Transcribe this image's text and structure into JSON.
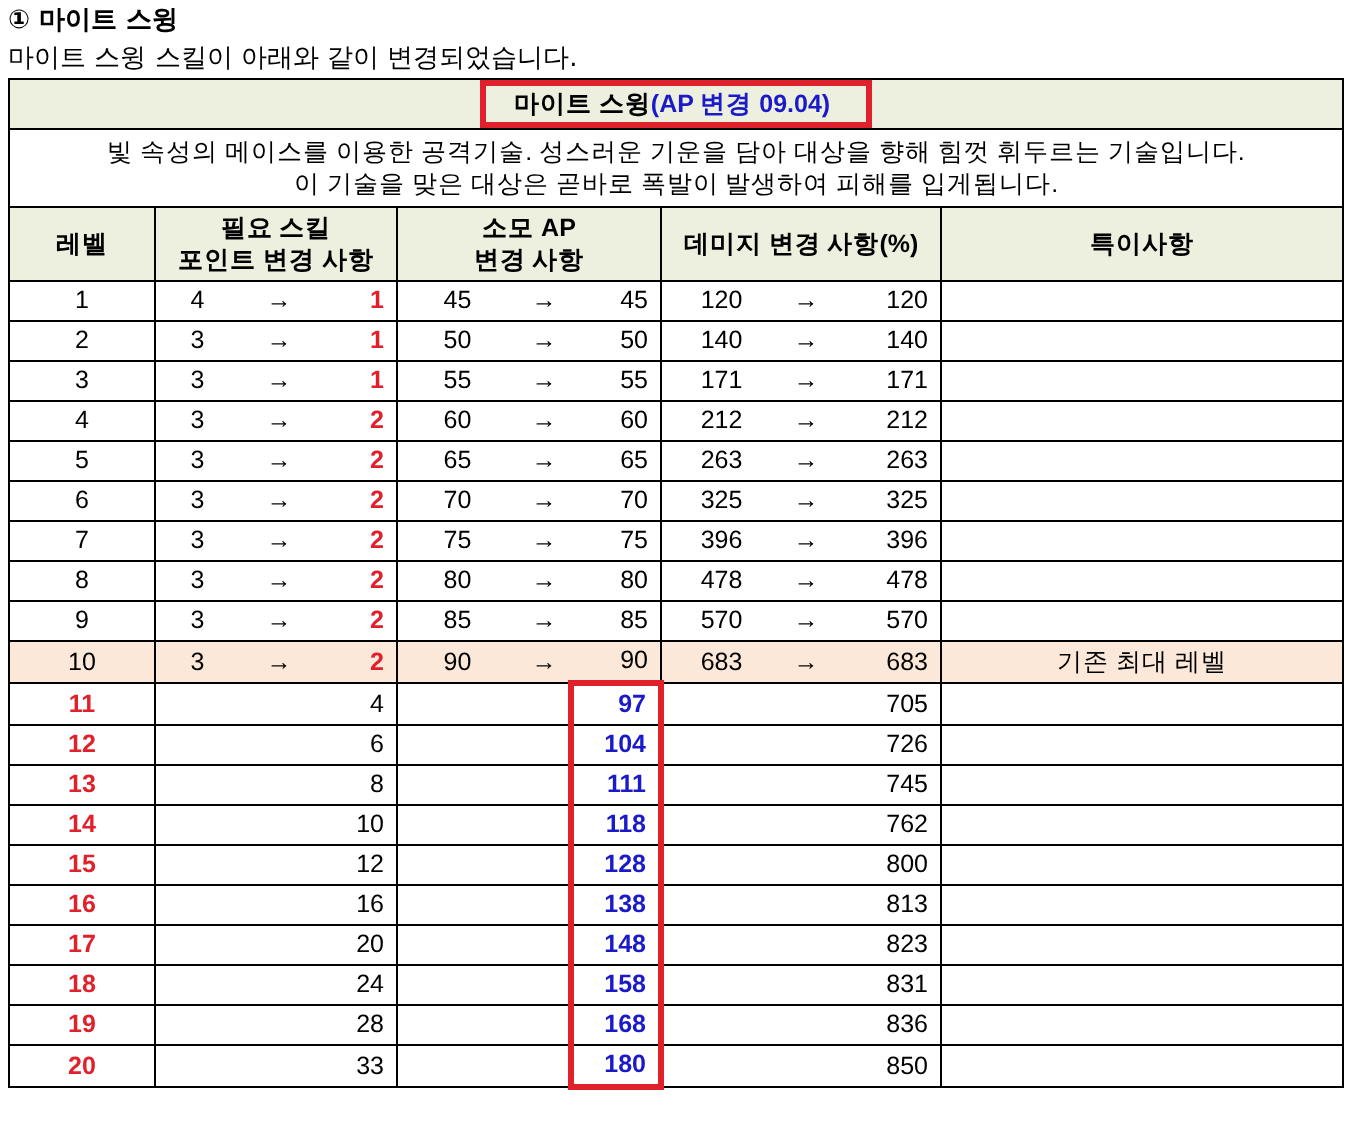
{
  "heading": "① 마이트 스윙",
  "intro": "마이트 스윙 스킬이 아래와 같이 변경되었습니다.",
  "table": {
    "title": {
      "name": "마이트 스윙",
      "note": "(AP 변경 09.04)"
    },
    "description": [
      "빛 속성의 메이스를 이용한 공격기술. 성스러운 기운을 담아 대상을 향해 힘껏 휘두르는 기술입니다.",
      "이 기술을 맞은 대상은 곧바로 폭발이 발생하여 피해를 입게됩니다."
    ],
    "columns": [
      [
        "레벨"
      ],
      [
        "필요 스킬",
        "포인트 변경 사항"
      ],
      [
        "소모 AP",
        "변경 사항"
      ],
      [
        "데미지 변경 사항(%)"
      ],
      [
        "특이사항"
      ]
    ],
    "rows": [
      {
        "kind": "existing",
        "highlighted": false,
        "level": "1",
        "skill": [
          "4",
          "→",
          "1"
        ],
        "ap": [
          "45",
          "→",
          "45"
        ],
        "damage": [
          "120",
          "→",
          "120"
        ]
      },
      {
        "kind": "existing",
        "highlighted": false,
        "level": "2",
        "skill": [
          "3",
          "→",
          "1"
        ],
        "ap": [
          "50",
          "→",
          "50"
        ],
        "damage": [
          "140",
          "→",
          "140"
        ]
      },
      {
        "kind": "existing",
        "highlighted": false,
        "level": "3",
        "skill": [
          "3",
          "→",
          "1"
        ],
        "ap": [
          "55",
          "→",
          "55"
        ],
        "damage": [
          "171",
          "→",
          "171"
        ]
      },
      {
        "kind": "existing",
        "highlighted": false,
        "level": "4",
        "skill": [
          "3",
          "→",
          "2"
        ],
        "ap": [
          "60",
          "→",
          "60"
        ],
        "damage": [
          "212",
          "→",
          "212"
        ]
      },
      {
        "kind": "existing",
        "highlighted": false,
        "level": "5",
        "skill": [
          "3",
          "→",
          "2"
        ],
        "ap": [
          "65",
          "→",
          "65"
        ],
        "damage": [
          "263",
          "→",
          "263"
        ]
      },
      {
        "kind": "existing",
        "highlighted": false,
        "level": "6",
        "skill": [
          "3",
          "→",
          "2"
        ],
        "ap": [
          "70",
          "→",
          "70"
        ],
        "damage": [
          "325",
          "→",
          "325"
        ]
      },
      {
        "kind": "existing",
        "highlighted": false,
        "level": "7",
        "skill": [
          "3",
          "→",
          "2"
        ],
        "ap": [
          "75",
          "→",
          "75"
        ],
        "damage": [
          "396",
          "→",
          "396"
        ]
      },
      {
        "kind": "existing",
        "highlighted": false,
        "level": "8",
        "skill": [
          "3",
          "→",
          "2"
        ],
        "ap": [
          "80",
          "→",
          "80"
        ],
        "damage": [
          "478",
          "→",
          "478"
        ]
      },
      {
        "kind": "existing",
        "highlighted": false,
        "level": "9",
        "skill": [
          "3",
          "→",
          "2"
        ],
        "ap": [
          "85",
          "→",
          "85"
        ],
        "damage": [
          "570",
          "→",
          "570"
        ]
      },
      {
        "kind": "existing",
        "highlighted": true,
        "level": "10",
        "skill": [
          "3",
          "→",
          "2"
        ],
        "ap": [
          "90",
          "→",
          "90"
        ],
        "damage": [
          "683",
          "→",
          "683"
        ],
        "note": "기존 최대 레벨"
      },
      {
        "kind": "added",
        "highlighted": false,
        "level": "11",
        "skill": [
          "4"
        ],
        "ap": [
          "97"
        ],
        "damage": [
          "705"
        ]
      },
      {
        "kind": "added",
        "highlighted": false,
        "level": "12",
        "skill": [
          "6"
        ],
        "ap": [
          "104"
        ],
        "damage": [
          "726"
        ]
      },
      {
        "kind": "added",
        "highlighted": false,
        "level": "13",
        "skill": [
          "8"
        ],
        "ap": [
          "111"
        ],
        "damage": [
          "745"
        ]
      },
      {
        "kind": "added",
        "highlighted": false,
        "level": "14",
        "skill": [
          "10"
        ],
        "ap": [
          "118"
        ],
        "damage": [
          "762"
        ]
      },
      {
        "kind": "added",
        "highlighted": false,
        "level": "15",
        "skill": [
          "12"
        ],
        "ap": [
          "128"
        ],
        "damage": [
          "800"
        ]
      },
      {
        "kind": "added",
        "highlighted": false,
        "level": "16",
        "skill": [
          "16"
        ],
        "ap": [
          "138"
        ],
        "damage": [
          "813"
        ]
      },
      {
        "kind": "added",
        "highlighted": false,
        "level": "17",
        "skill": [
          "20"
        ],
        "ap": [
          "148"
        ],
        "damage": [
          "823"
        ]
      },
      {
        "kind": "added",
        "highlighted": false,
        "level": "18",
        "skill": [
          "24"
        ],
        "ap": [
          "158"
        ],
        "damage": [
          "831"
        ]
      },
      {
        "kind": "added",
        "highlighted": false,
        "level": "19",
        "skill": [
          "28"
        ],
        "ap": [
          "168"
        ],
        "damage": [
          "836"
        ]
      },
      {
        "kind": "added",
        "highlighted": false,
        "level": "20",
        "skill": [
          "33"
        ],
        "ap": [
          "180"
        ],
        "damage": [
          "850"
        ]
      }
    ]
  }
}
